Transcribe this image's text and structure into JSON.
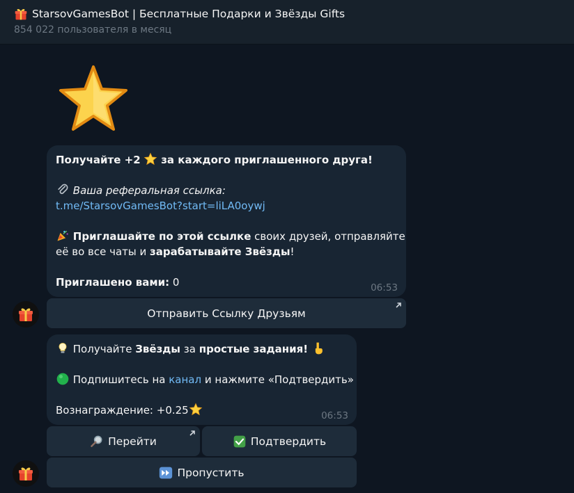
{
  "header": {
    "title": "StarsovGamesBot | Бесплатные Подарки и Звёзды Gifts",
    "subtitle": "854 022 пользователя в месяц",
    "title_icon": "gift-icon"
  },
  "sticker": {
    "icon": "star-sticker"
  },
  "message1": {
    "line1_pre": "Получайте +2",
    "line1_post": "за каждого приглашенного друга!",
    "referral_label": "Ваша реферальная ссылка:",
    "referral_link": "t.me/StarsovGamesBot?start=liLA0oywj",
    "invite_bold1": "Приглашайте по этой ссылке",
    "invite_rest1": "своих друзей, отправляйте",
    "invite_line2_pre": "её во все чаты и",
    "invite_bold2": "зарабатывайте Звёзды",
    "invite_line2_post": "!",
    "invited_label": "Приглашено вами:",
    "invited_count": "0",
    "time": "06:53"
  },
  "message1_buttons": {
    "send_link": "Отправить Ссылку Друзьям"
  },
  "message2": {
    "l1_pre": "Получайте",
    "l1_bold1": "Звёзды",
    "l1_mid": "за",
    "l1_bold2": "простые задания!",
    "l2_pre": "Подпишитесь на",
    "l2_link": "канал",
    "l2_post": "и нажмите «Подтвердить»",
    "reward": "Вознаграждение: +0.25",
    "time": "06:53"
  },
  "message2_buttons": {
    "go": "Перейти",
    "confirm": "Подтвердить",
    "skip": "Пропустить"
  },
  "colors": {
    "background": "#0e1621",
    "bubble": "#182533",
    "button": "#1e2c3a",
    "link": "#71baf5",
    "muted": "#6d7883"
  }
}
